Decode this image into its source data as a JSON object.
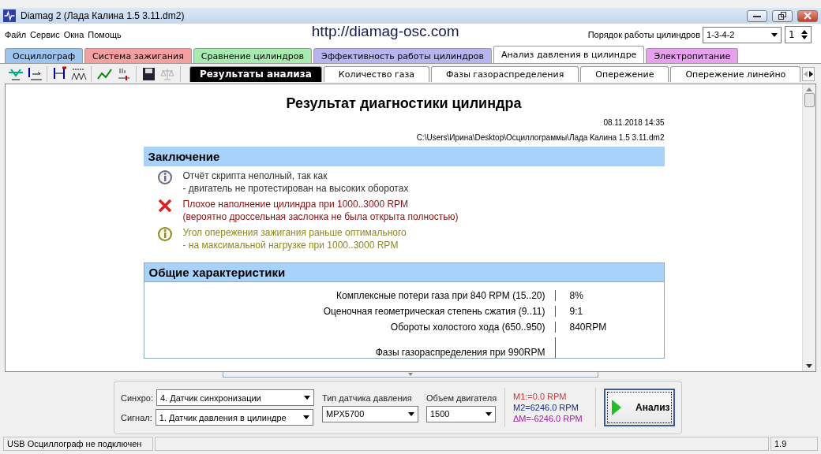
{
  "window": {
    "title": "Diamag 2 (Лада Калина 1.5 3.11.dm2)"
  },
  "menu": [
    "Файл",
    "Сервис",
    "Окна",
    "Помощь"
  ],
  "url": "http://diamag-osc.com",
  "cylinder_order": {
    "label": "Порядок работы цилиндров",
    "value": "1-3-4-2",
    "cylinder": "1"
  },
  "main_tabs": [
    {
      "label": "Осциллограф",
      "selected": false,
      "color": "#9cc4ee"
    },
    {
      "label": "Система зажигания",
      "selected": false,
      "color": "#f4a0a0"
    },
    {
      "label": "Сравнение цилиндров",
      "selected": false,
      "color": "#a8ebb0"
    },
    {
      "label": "Эффективность работы цилиндров",
      "selected": false,
      "color": "#b8b4f0"
    },
    {
      "label": "Анализ давления в цилиндре",
      "selected": true,
      "color": "#ffffff"
    },
    {
      "label": "Электропитание",
      "selected": false,
      "color": "#e6a0ee"
    }
  ],
  "sub_tabs": [
    {
      "label": "Результаты анализа",
      "selected": true
    },
    {
      "label": "Количество газа",
      "selected": false
    },
    {
      "label": "Фазы газораспределения",
      "selected": false
    },
    {
      "label": "Опережение",
      "selected": false
    },
    {
      "label": "Опережение линейно",
      "selected": false
    }
  ],
  "report": {
    "title": "Результат диагностики цилиндра",
    "date": "08.11.2018 14:35",
    "path": "C:\\Users\\Ирина\\Desktop\\Осциллограммы\\Лада Калина 1.5 3.11.dm2",
    "conclusion": {
      "heading": "Заключение",
      "items": [
        {
          "kind": "info",
          "lines": [
            "Отчёт скрипта неполный, так как",
            "- двигатель не протестирован на высоких оборотах"
          ]
        },
        {
          "kind": "error",
          "lines": [
            "Плохое наполнение цилиндра при 1000..3000 RPM",
            "(вероятно дроссельная заслонка не была открыта полностью)"
          ]
        },
        {
          "kind": "warning",
          "lines": [
            "Угол опережения зажигания раньше оптимального",
            "- на максимальной нагрузке при 1000..3000 RPM"
          ]
        }
      ]
    },
    "general": {
      "heading": "Общие характеристики",
      "rows": [
        {
          "label": "Комплексные потери газа при 840 RPM (15..20)",
          "value": "8%"
        },
        {
          "label": "Оценочная геометрическая степень сжатия (9..11)",
          "value": "9:1"
        },
        {
          "label": "Обороты холостого хода (650..950)",
          "value": "840RPM"
        },
        {
          "label": "Фазы газораспределения при 990RPM"
        }
      ]
    }
  },
  "controls": {
    "sync_label": "Синхро:",
    "sync_value": "4.  Датчик синхронизации",
    "signal_label": "Сигнал:",
    "signal_value": "1.  Датчик давления в цилиндре",
    "sensor_label": "Тип датчика давления",
    "sensor_value": "MPX5700",
    "volume_label": "Объем двигателя",
    "volume_value": "1500",
    "readings": [
      {
        "text": "M1:=0.0 RPM",
        "color": "#e03030"
      },
      {
        "text": "M2=6246.0 RPM",
        "color": "#1a2a8a"
      },
      {
        "text": "ΔM=-6246.0 RPM",
        "color": "#a020a0"
      }
    ],
    "analyze": "Анализ"
  },
  "status_bar": {
    "connection": "USB Осциллограф не подключен",
    "version": "1.9"
  }
}
